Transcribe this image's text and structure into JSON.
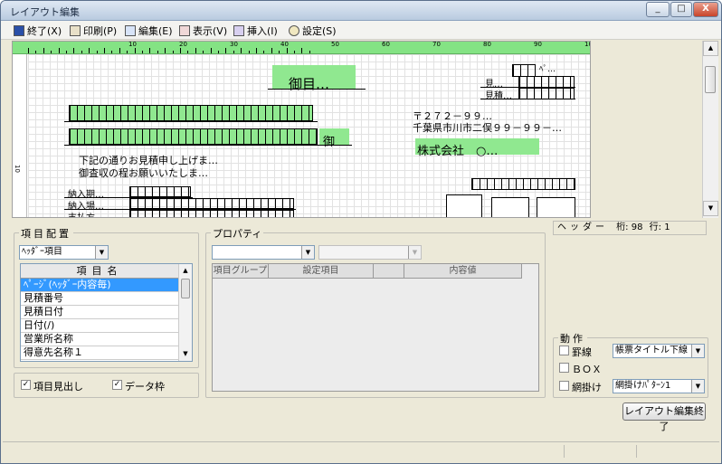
{
  "window": {
    "title": "レイアウト編集",
    "min": "_",
    "max": "□",
    "close": "X"
  },
  "menu": [
    {
      "label": "終了(X)",
      "icon": "exit-icon"
    },
    {
      "label": "印刷(P)",
      "icon": "printer-icon"
    },
    {
      "label": "編集(E)",
      "icon": "edit-icon"
    },
    {
      "label": "表示(V)",
      "icon": "view-icon"
    },
    {
      "label": "挿入(I)",
      "icon": "insert-icon"
    },
    {
      "label": "設定(S)",
      "icon": "settings-icon"
    }
  ],
  "ruler": {
    "numbers": [
      "10",
      "20",
      "30",
      "40",
      "50",
      "60",
      "70",
      "80",
      "90",
      "100"
    ],
    "vnum": "10"
  },
  "doc": {
    "title": "御目…",
    "mi": "見…",
    "mitsumori": "見積…",
    "pe": "ﾍﾟ…",
    "on": "御",
    "zip": "〒２７２－９９…",
    "address": "千葉県市川市二俣９９－９９－…",
    "company": "株式会社　○…",
    "line1": "下記の通りお見積申し上げま…",
    "line2": "御査収の程お願いいたしま…",
    "nyuki": "納入期…",
    "nyubasho": "納入場…",
    "shiharai": "支払方…"
  },
  "item_group": {
    "label": "項目配置",
    "combo_value": "ﾍｯﾀﾞｰ項目",
    "list_header": "項目名",
    "items": [
      "ﾍﾟｰｼﾞ(ﾍｯﾀﾞｰ内容毎)",
      "見積番号",
      "見積日付",
      "日付(/)",
      "営業所名称",
      "得意先名称１"
    ],
    "selected_index": 0,
    "chk_heading": "項目見出し",
    "chk_heading_checked": true,
    "chk_frame": "データ枠",
    "chk_frame_checked": true
  },
  "property": {
    "label": "プロパティ",
    "combo1": "",
    "combo2": "",
    "columns": [
      "項目グループ",
      "設定項目",
      "",
      "内容値"
    ]
  },
  "info": {
    "header": "ヘッダー",
    "col": "桁: 98",
    "row": "行: 1"
  },
  "action": {
    "label": "動作",
    "keisen": "罫線",
    "keisen_value": "帳票タイトル下線",
    "box": "ＢＯＸ",
    "amikake": "網掛け",
    "amikake_value": "網掛けﾊﾟﾀｰﾝ1"
  },
  "finish_button": "レイアウト編集終了",
  "colors": {
    "green": "#90e890",
    "select": "#3399ff"
  }
}
